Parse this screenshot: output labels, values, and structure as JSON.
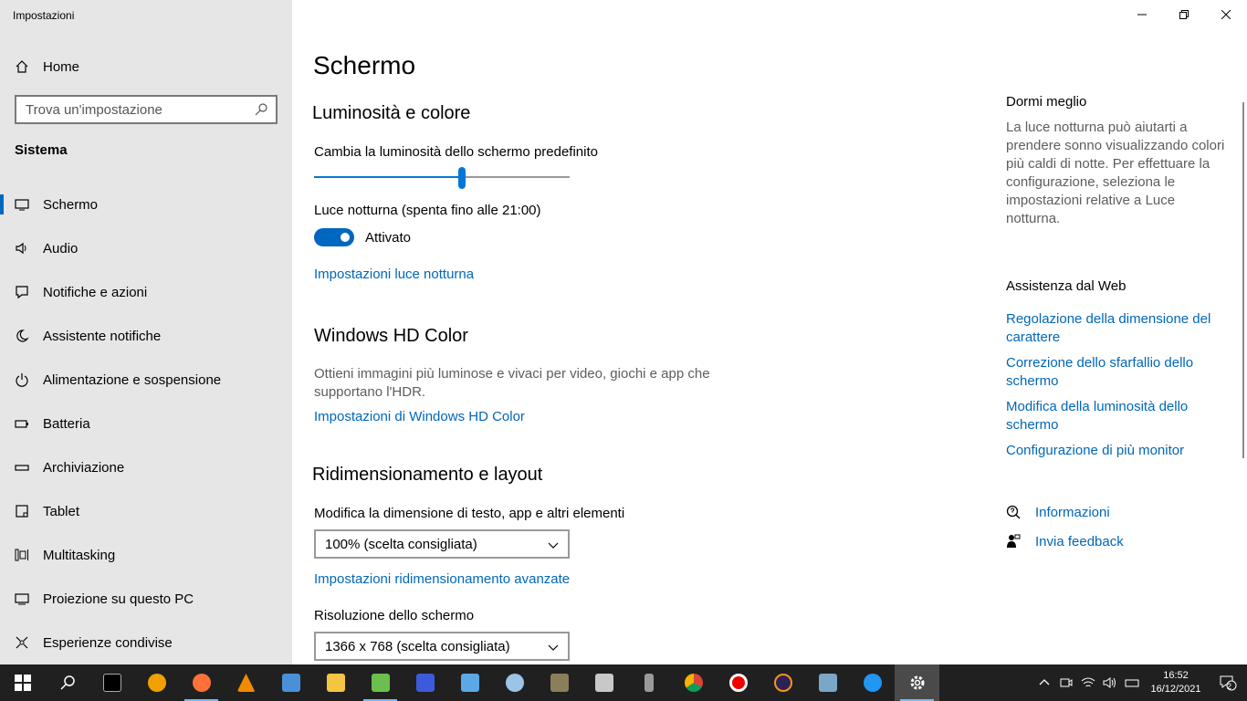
{
  "window": {
    "title": "Impostazioni"
  },
  "sidebar": {
    "home_label": "Home",
    "search_placeholder": "Trova un'impostazione",
    "section": "Sistema",
    "items": [
      {
        "label": "Schermo",
        "icon": "monitor-icon"
      },
      {
        "label": "Audio",
        "icon": "speaker-icon"
      },
      {
        "label": "Notifiche e azioni",
        "icon": "notification-icon"
      },
      {
        "label": "Assistente notifiche",
        "icon": "moon-icon"
      },
      {
        "label": "Alimentazione e sospensione",
        "icon": "power-icon"
      },
      {
        "label": "Batteria",
        "icon": "battery-icon"
      },
      {
        "label": "Archiviazione",
        "icon": "storage-icon"
      },
      {
        "label": "Tablet",
        "icon": "tablet-icon"
      },
      {
        "label": "Multitasking",
        "icon": "multitasking-icon"
      },
      {
        "label": "Proiezione su questo PC",
        "icon": "projection-icon"
      },
      {
        "label": "Esperienze condivise",
        "icon": "shared-icon"
      }
    ]
  },
  "main": {
    "title": "Schermo",
    "brightness": {
      "heading": "Luminosità e colore",
      "label": "Cambia la luminosità dello schermo predefinito",
      "value": 0.58
    },
    "night_light": {
      "label": "Luce notturna (spenta fino alle 21:00)",
      "state": "Attivato",
      "link": "Impostazioni luce notturna"
    },
    "hdr": {
      "heading": "Windows HD Color",
      "description": "Ottieni immagini più luminose e vivaci per video, giochi e app che supportano l'HDR.",
      "link": "Impostazioni di Windows HD Color"
    },
    "scaling": {
      "heading": "Ridimensionamento e layout",
      "size_label": "Modifica la dimensione di testo, app e altri elementi",
      "size_value": "100% (scelta consigliata)",
      "advanced_link": "Impostazioni ridimensionamento avanzate",
      "resolution_label": "Risoluzione dello schermo",
      "resolution_value": "1366 x 768 (scelta consigliata)"
    }
  },
  "right": {
    "sleep_heading": "Dormi meglio",
    "sleep_text": "La luce notturna può aiutarti a prendere sonno visualizzando colori più caldi di notte. Per effettuare la configurazione, seleziona le impostazioni relative a Luce notturna.",
    "web_heading": "Assistenza dal Web",
    "links": [
      "Regolazione della dimensione del carattere",
      "Correzione dello sfarfallio dello schermo",
      "Modifica della luminosità dello schermo",
      "Configurazione di più monitor"
    ],
    "info": "Informazioni",
    "feedback": "Invia feedback"
  },
  "tray": {
    "time": "16:52",
    "date": "16/12/2021",
    "notification_count": "2"
  },
  "taskbar": {
    "apps": [
      "terminal",
      "app",
      "firefox",
      "vlc",
      "calculator",
      "explorer",
      "notepad",
      "save",
      "app2",
      "paint",
      "app3",
      "app4",
      "mic",
      "chrome",
      "record",
      "eclipse",
      "app5",
      "app6",
      "settings"
    ]
  }
}
